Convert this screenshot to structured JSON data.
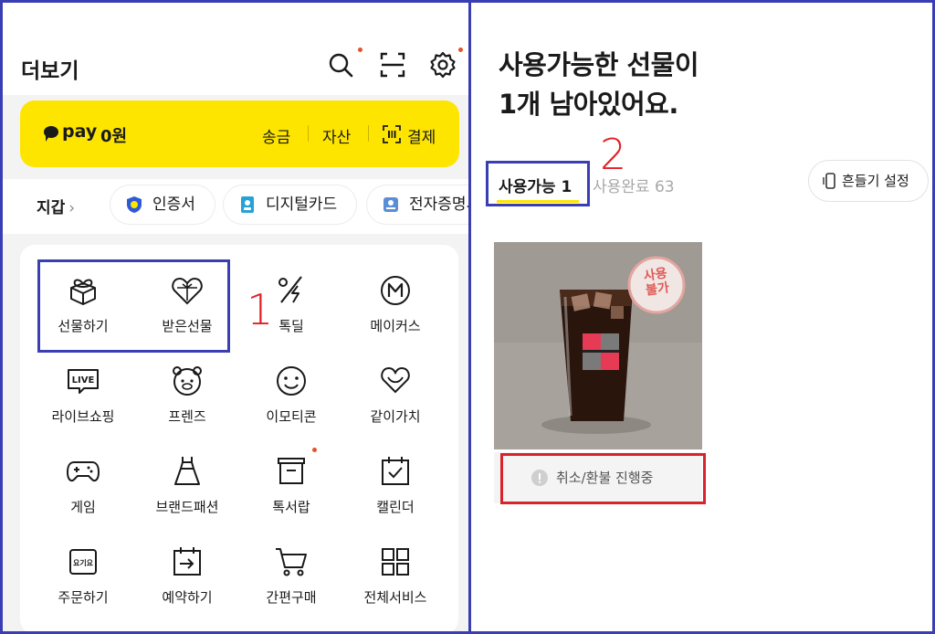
{
  "more": {
    "title": "더보기",
    "icons": [
      "search-icon",
      "scan-icon",
      "gear-icon"
    ],
    "pay": {
      "logo": "pay",
      "amount": "0원",
      "actions": [
        "송금",
        "자산",
        "결제"
      ]
    },
    "wallet": {
      "label": "지갑",
      "chips": [
        "인증서",
        "디지털카드",
        "전자증명서"
      ]
    },
    "services": [
      {
        "label": "선물하기",
        "icon": "gift-icon"
      },
      {
        "label": "받은선물",
        "icon": "received-gift-icon"
      },
      {
        "label": "톡딜",
        "icon": "percent-icon"
      },
      {
        "label": "메이커스",
        "icon": "makers-icon"
      },
      {
        "label": "라이브쇼핑",
        "icon": "live-icon"
      },
      {
        "label": "프렌즈",
        "icon": "bear-icon"
      },
      {
        "label": "이모티콘",
        "icon": "smile-icon"
      },
      {
        "label": "같이가치",
        "icon": "heart-icon"
      },
      {
        "label": "게임",
        "icon": "gamepad-icon"
      },
      {
        "label": "브랜드패션",
        "icon": "dress-icon"
      },
      {
        "label": "톡서랍",
        "icon": "drawer-icon"
      },
      {
        "label": "캘린더",
        "icon": "calendar-icon"
      },
      {
        "label": "주문하기",
        "icon": "order-icon"
      },
      {
        "label": "예약하기",
        "icon": "reserve-icon"
      },
      {
        "label": "간편구매",
        "icon": "cart-icon"
      },
      {
        "label": "전체서비스",
        "icon": "grid-icon"
      }
    ],
    "annotation": "1"
  },
  "gifts": {
    "headline_line1": "사용가능한 선물이",
    "headline_line2": "1개 남아있어요.",
    "tab_available": "사용가능 1",
    "tab_used": "사용완료 63",
    "shake_setting": "흔들기 설정",
    "stamp_line1": "사용",
    "stamp_line2": "불가",
    "status": "취소/환불 진행중",
    "annotation": "2"
  },
  "colors": {
    "kakao_yellow": "#fee500",
    "frame_blue": "#3a3eb3",
    "annotation_red": "#e21f26"
  }
}
